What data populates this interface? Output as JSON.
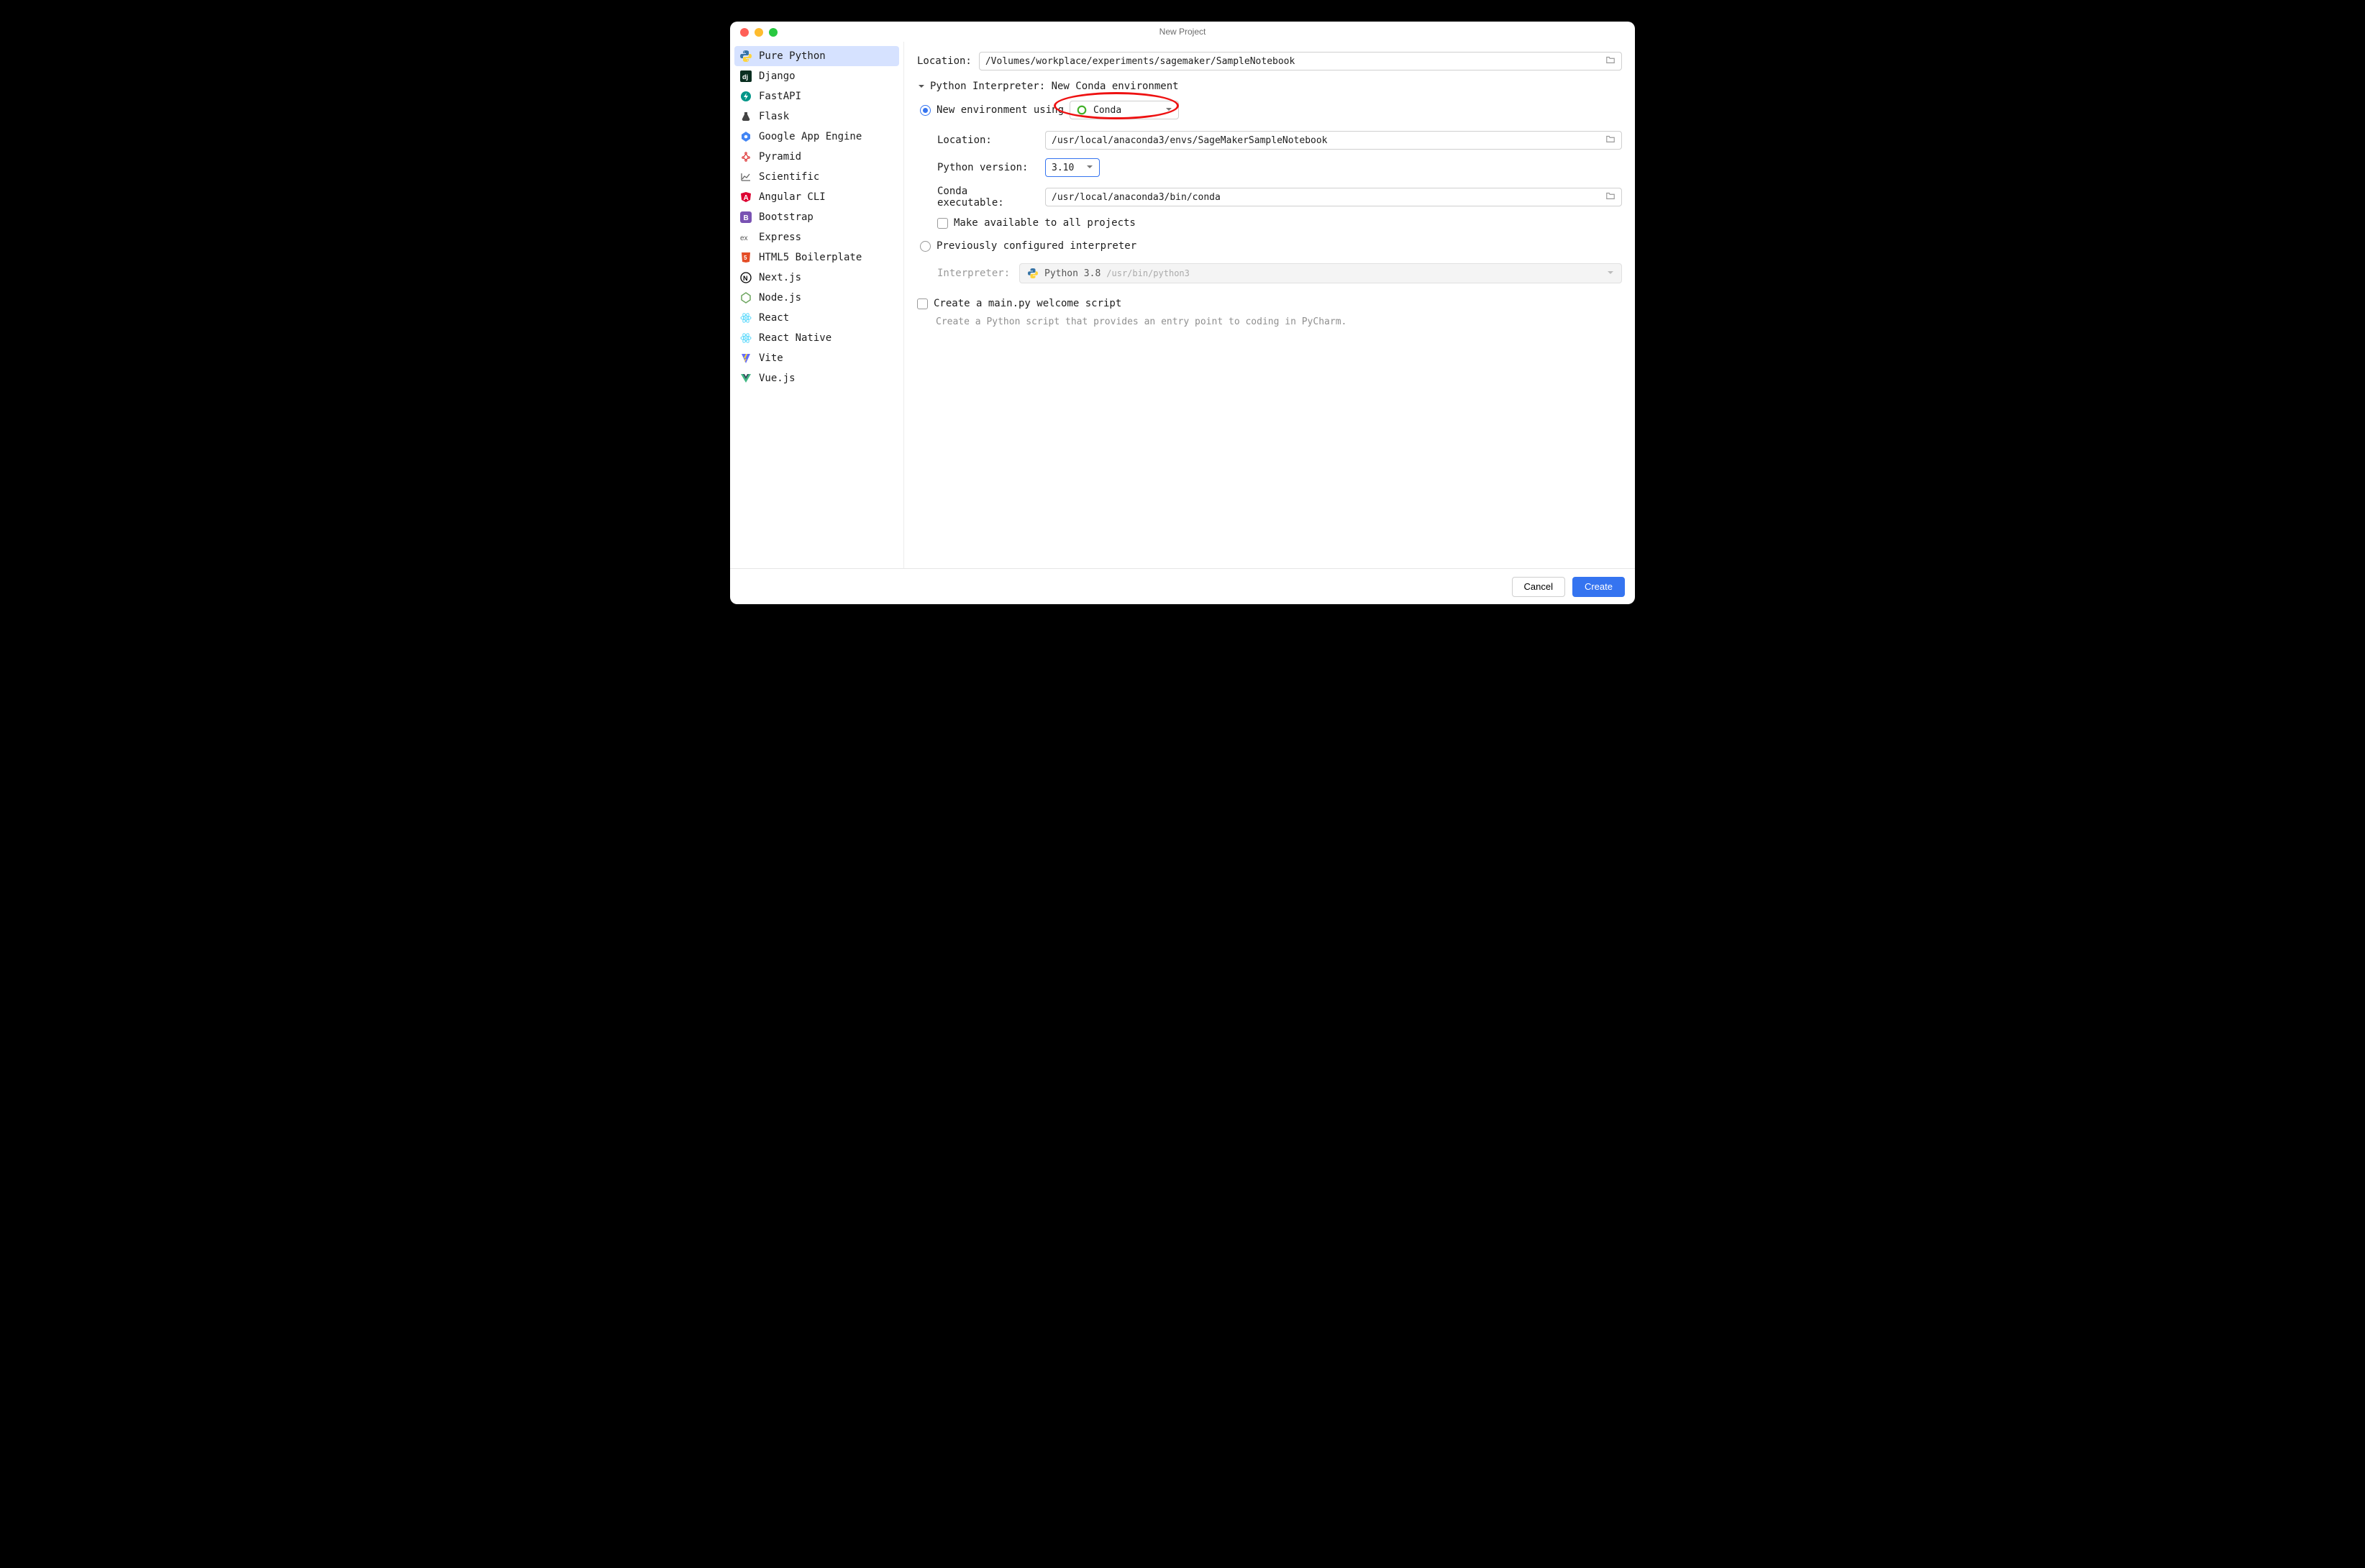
{
  "window": {
    "title": "New Project"
  },
  "sidebar": {
    "items": [
      {
        "label": "Pure Python"
      },
      {
        "label": "Django"
      },
      {
        "label": "FastAPI"
      },
      {
        "label": "Flask"
      },
      {
        "label": "Google App Engine"
      },
      {
        "label": "Pyramid"
      },
      {
        "label": "Scientific"
      },
      {
        "label": "Angular CLI"
      },
      {
        "label": "Bootstrap"
      },
      {
        "label": "Express"
      },
      {
        "label": "HTML5 Boilerplate"
      },
      {
        "label": "Next.js"
      },
      {
        "label": "Node.js"
      },
      {
        "label": "React"
      },
      {
        "label": "React Native"
      },
      {
        "label": "Vite"
      },
      {
        "label": "Vue.js"
      }
    ]
  },
  "form": {
    "location_label": "Location:",
    "location_value": "/Volumes/workplace/experiments/sagemaker/SampleNotebook",
    "interpreter_section": "Python Interpreter: New Conda environment",
    "new_env_label": "New environment using",
    "env_tool": "Conda",
    "env_location_label": "Location:",
    "env_location_value": "/usr/local/anaconda3/envs/SageMakerSampleNotebook",
    "py_version_label": "Python version:",
    "py_version_value": "3.10",
    "conda_exec_label": "Conda executable:",
    "conda_exec_value": "/usr/local/anaconda3/bin/conda",
    "make_available_label": "Make available to all projects",
    "prev_config_label": "Previously configured interpreter",
    "interpreter_label": "Interpreter:",
    "interpreter_name": "Python 3.8",
    "interpreter_path": "/usr/bin/python3",
    "create_main_label": "Create a main.py welcome script",
    "create_main_hint": "Create a Python script that provides an entry point to coding in PyCharm."
  },
  "footer": {
    "cancel": "Cancel",
    "create": "Create"
  }
}
